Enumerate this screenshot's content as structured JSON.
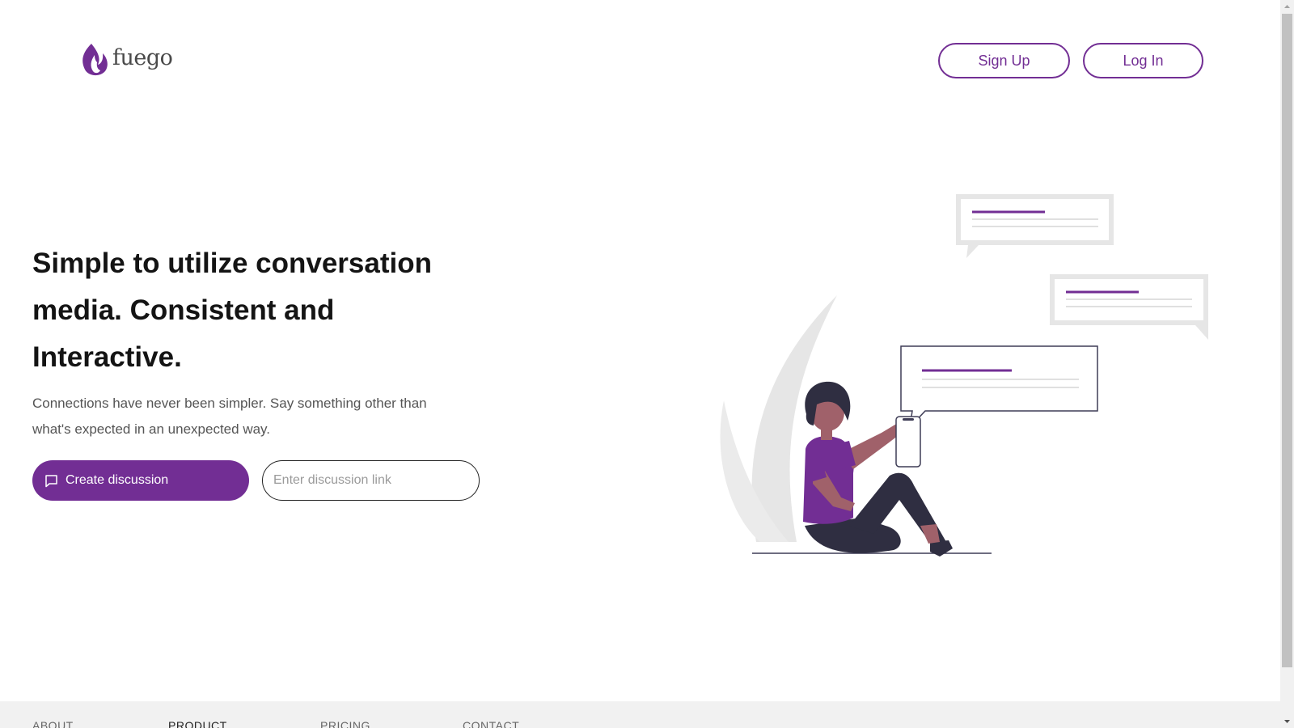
{
  "header": {
    "logo_text": "fuego",
    "signup_label": "Sign Up",
    "login_label": "Log In"
  },
  "hero": {
    "title": "Simple to utilize conversation media. Consistent and Interactive.",
    "subtitle": "Connections have never been simpler. Say something other than what's expected in an unexpected way.",
    "create_button_label": "Create discussion",
    "link_input": {
      "value": "",
      "placeholder": "Enter discussion link"
    }
  },
  "footer": {
    "links": [
      "ABOUT",
      "PRODUCT",
      "PRICING",
      "CONTACT"
    ]
  },
  "icons": {
    "logo": "flame-icon",
    "create": "chat-bubble-icon"
  },
  "colors": {
    "brand": "#722e94",
    "text_dark": "#141414",
    "text_muted": "#555555",
    "footer_bg": "#f1f1f1"
  }
}
